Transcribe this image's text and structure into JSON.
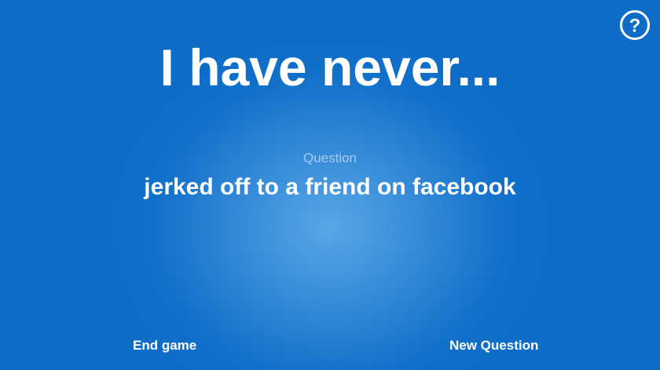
{
  "header": {
    "title": "I have never...",
    "help_icon": "question-circle-icon"
  },
  "main": {
    "question_label": "Question",
    "question_text": "jerked off to a friend on facebook"
  },
  "footer": {
    "end_game_label": "End game",
    "new_question_label": "New Question"
  },
  "colors": {
    "background": "#0d6cc6",
    "background_glow": "#5aa6e6",
    "text": "#ffffff",
    "label_text": "#a9cbe9"
  }
}
